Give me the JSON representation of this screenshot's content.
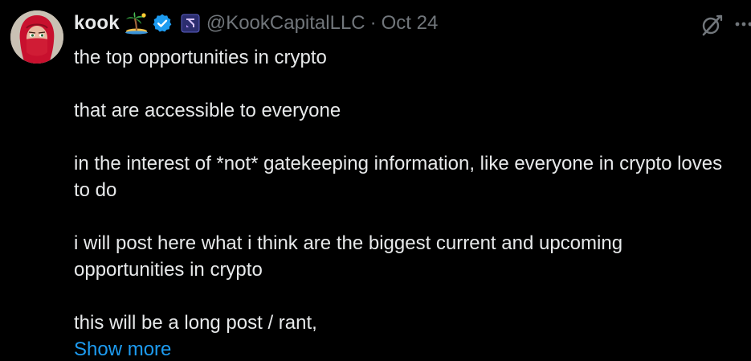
{
  "author": {
    "name": "kook",
    "handle": "@KookCapitalLLC",
    "separator": "·",
    "date": "Oct 24",
    "icons": [
      "island-emoji-icon",
      "verified-badge-icon",
      "affiliate-badge-icon"
    ]
  },
  "post": {
    "paragraphs": [
      "the top opportunities in crypto",
      "that are accessible to everyone",
      "in the interest of *not* gatekeeping information, like everyone in crypto loves to do",
      "i will post here what i think are the biggest current and upcoming opportunities in crypto",
      "this will be a long post / rant,"
    ],
    "show_more": "Show more"
  },
  "colors": {
    "background": "#000000",
    "text": "#e7e9ea",
    "secondary": "#71767b",
    "link": "#1d9bf0",
    "verified": "#1d9bf0"
  }
}
